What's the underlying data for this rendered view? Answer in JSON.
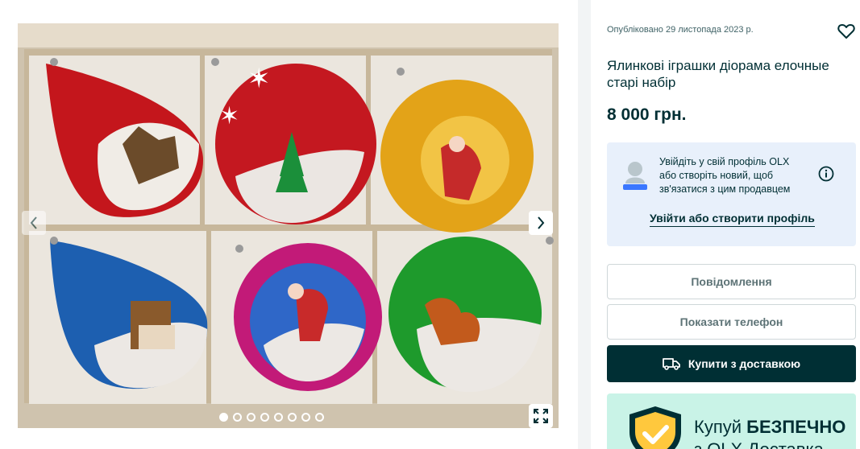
{
  "gallery": {
    "dots_count": 8,
    "active_index": 0
  },
  "listing": {
    "posted": "Опубліковано 29 листопада 2023 р.",
    "title": "Ялинкові іграшки діорама елочные старі набір",
    "price": "8 000 грн."
  },
  "login_prompt": {
    "text": "Увійдіть у свій профіль OLX або створіть новий, щоб зв'язатися з цим продавцем",
    "link": "Увійти або створити профіль"
  },
  "actions": {
    "message": "Повідомлення",
    "phone": "Показати телефон",
    "buy": "Купити з доставкою"
  },
  "promo": {
    "line1_prefix": "Купуй ",
    "line1_bold": "БЕЗПЕЧНО",
    "line2": "з OLX Доставка"
  },
  "colors": {
    "brand_dark": "#002f34",
    "login_bg": "#e8f0fb",
    "promo_bg": "#c9f3e7"
  },
  "icons": [
    "chevron-left-icon",
    "chevron-right-icon",
    "fullscreen-icon",
    "heart-icon",
    "avatar-icon",
    "info-icon",
    "truck-icon",
    "shield-check-icon"
  ]
}
